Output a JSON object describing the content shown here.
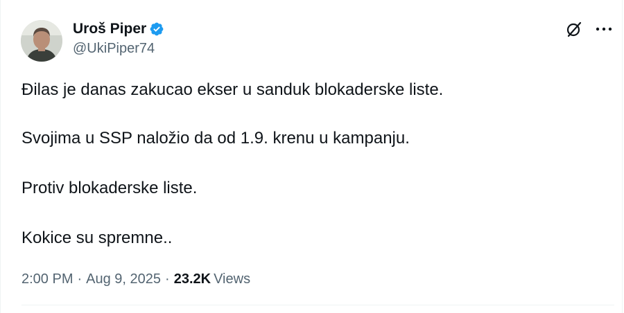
{
  "author": {
    "display_name": "Uroš Piper",
    "handle": "@UkiPiper74",
    "verified": true,
    "verified_color": "#1d9bf0"
  },
  "header_icons": [
    "grok-icon",
    "more-options-icon"
  ],
  "tweet": {
    "lines": [
      "Đilas je danas zakucao ekser u sanduk blokaderske liste.",
      "Svojima u SSP naložio da od 1.9. krenu u kampanju.",
      "Protiv blokaderske liste.",
      "Kokice su spremne.."
    ]
  },
  "meta": {
    "time": "2:00 PM",
    "separator": "·",
    "date": "Aug 9, 2025",
    "views_count": "23.2K",
    "views_label": "Views"
  },
  "colors": {
    "text": "#0f1419",
    "secondary": "#536471",
    "divider": "#eff3f4"
  }
}
